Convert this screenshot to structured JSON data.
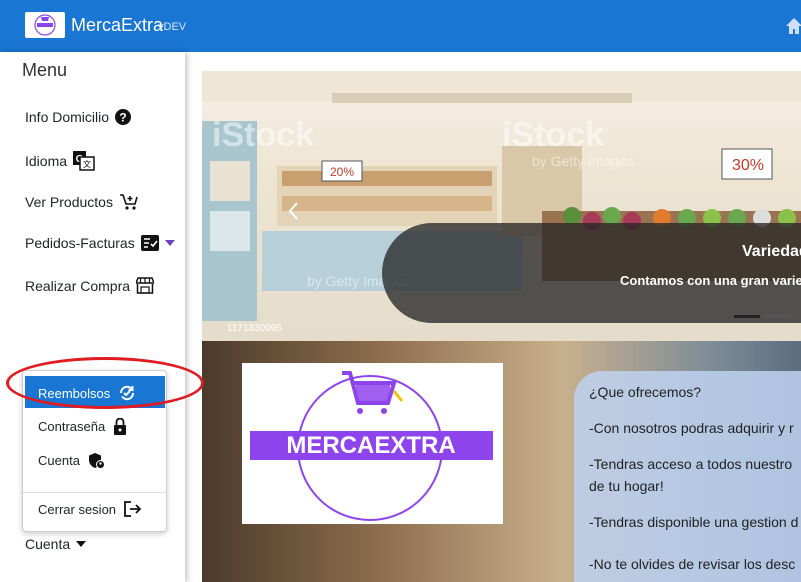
{
  "app": {
    "title": "MercaExtra",
    "version": "vDEV",
    "logo_text": "MERCAEXTRA"
  },
  "sidebar": {
    "title": "Menu",
    "items": [
      {
        "label": "Info Domicilio",
        "icon": "question-circle-icon"
      },
      {
        "label": "Idioma",
        "icon": "translate-icon"
      },
      {
        "label": "Ver Productos",
        "icon": "cart-plus-icon"
      },
      {
        "label": "Pedidos-Facturas",
        "icon": "checklist-icon"
      },
      {
        "label": "Realizar Compra",
        "icon": "shop-icon"
      }
    ]
  },
  "account_menu": {
    "toggle_label": "Cuenta",
    "items": [
      {
        "label": "Reembolsos",
        "icon": "refund-icon",
        "active": true
      },
      {
        "label": "Contraseña",
        "icon": "lock-icon"
      },
      {
        "label": "Cuenta",
        "icon": "user-shield-icon"
      },
      {
        "label": "Cerrar sesion",
        "icon": "logout-icon"
      }
    ]
  },
  "carousel": {
    "title": "Variedad",
    "text": "Contamos con una gran variedad",
    "watermark": "iStock",
    "watermark_sub": "by Getty Images",
    "image_id": "1171830095",
    "price_tags": [
      "20%",
      "30%"
    ]
  },
  "info": {
    "heading": "¿Que ofrecemos?",
    "lines": [
      "-Con nosotros podras adquirir y r",
      "-Tendras acceso a todos nuestro",
      "de tu hogar!",
      "-Tendras disponible una gestion d",
      "-No te olvides de revisar los desc"
    ]
  },
  "colors": {
    "primary": "#1976d2",
    "logo_purple": "#8e44ec",
    "highlight": "#e01b22"
  }
}
